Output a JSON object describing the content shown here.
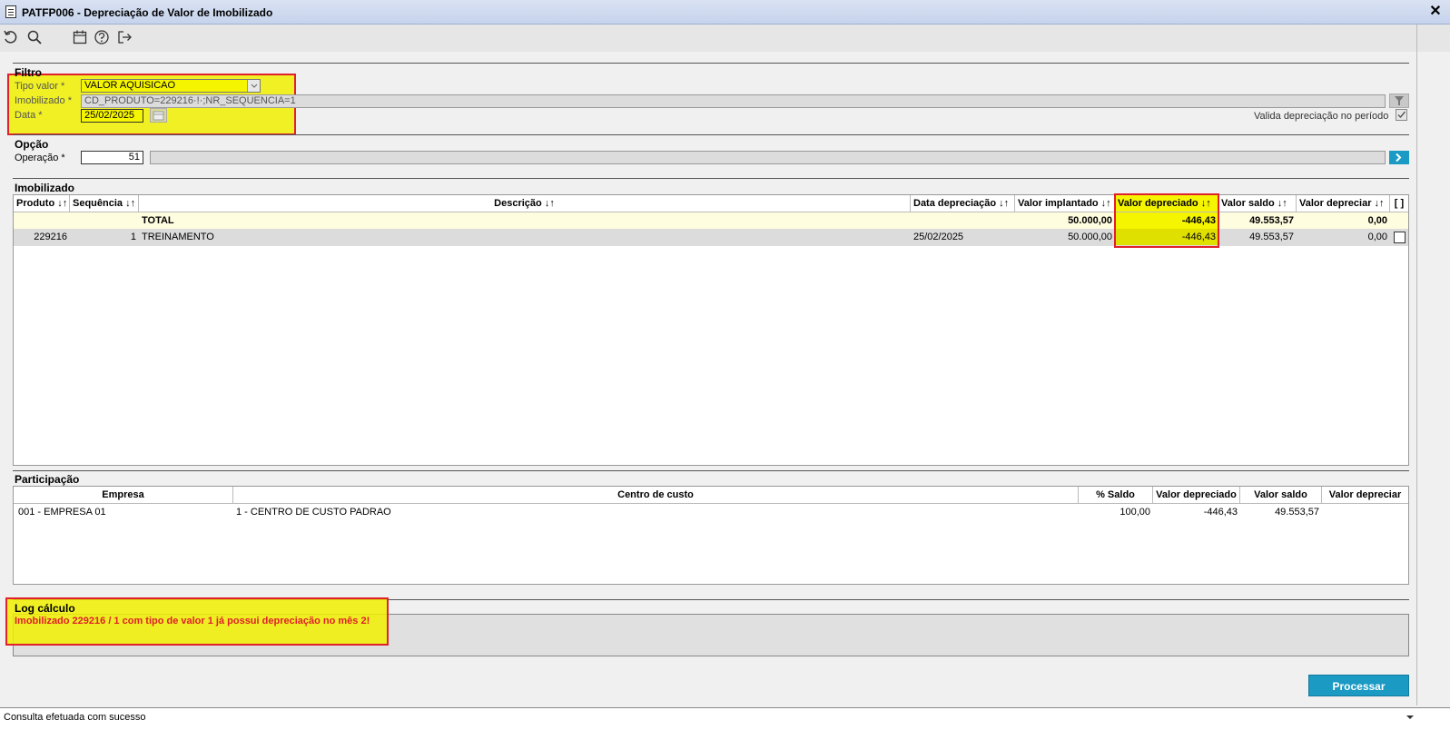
{
  "window": {
    "title": "PATFP006 - Depreciação de Valor de Imobilizado",
    "close_symbol": "✕"
  },
  "toolbar": {
    "icons": [
      "undo-icon",
      "search-icon",
      "calendar-icon",
      "help-icon",
      "exit-icon"
    ]
  },
  "filtro": {
    "section_title": "Filtro",
    "tipo_valor_label": "Tipo valor *",
    "tipo_valor_value": "VALOR AQUISICAO",
    "imobilizado_label": "Imobilizado *",
    "imobilizado_value": "CD_PRODUTO=229216·!·;NR_SEQUENCIA=1",
    "data_label": "Data *",
    "data_value": "25/02/2025",
    "valida_label": "Valida depreciação no período"
  },
  "opcao": {
    "section_title": "Opção",
    "operacao_label": "Operação *",
    "operacao_value": "51"
  },
  "imobilizado_table": {
    "section_title": "Imobilizado",
    "headers": {
      "produto": "Produto ↓↑",
      "sequencia": "Sequência ↓↑",
      "descricao": "Descrição ↓↑",
      "data_depreciacao": "Data depreciação ↓↑",
      "valor_implantado": "Valor implantado ↓↑",
      "valor_depreciado": "Valor depreciado ↓↑",
      "valor_saldo": "Valor saldo ↓↑",
      "valor_depreciar": "Valor depreciar ↓↑",
      "select": "[ ]"
    },
    "total_row": {
      "label": "TOTAL",
      "valor_implantado": "50.000,00",
      "valor_depreciado": "-446,43",
      "valor_saldo": "49.553,57",
      "valor_depreciar": "0,00"
    },
    "rows": [
      {
        "produto": "229216",
        "sequencia": "1",
        "descricao": "TREINAMENTO",
        "data_depreciacao": "25/02/2025",
        "valor_implantado": "50.000,00",
        "valor_depreciado": "-446,43",
        "valor_saldo": "49.553,57",
        "valor_depreciar": "0,00"
      }
    ]
  },
  "participacao": {
    "section_title": "Participação",
    "headers": {
      "empresa": "Empresa",
      "centro_custo": "Centro de custo",
      "pct_saldo": "% Saldo",
      "valor_depreciado": "Valor depreciado",
      "valor_saldo": "Valor saldo",
      "valor_depreciar": "Valor depreciar"
    },
    "rows": [
      {
        "empresa": "001 - EMPRESA 01",
        "centro_custo": "1 - CENTRO DE CUSTO PADRAO",
        "pct_saldo": "100,00",
        "valor_depreciado": "-446,43",
        "valor_saldo": "49.553,57",
        "valor_depreciar": ""
      }
    ]
  },
  "log": {
    "section_title": "Log cálculo",
    "message": "Imobilizado 229216 / 1 com tipo de valor 1 já possui depreciação no mês 2!"
  },
  "actions": {
    "processar_label": "Processar"
  },
  "statusbar": {
    "message": "Consulta efetuada com sucesso"
  },
  "colors": {
    "highlight": "#f6f500",
    "outline": "#e0202a",
    "accent": "#1b9ac4",
    "log_text": "#e0202a"
  }
}
